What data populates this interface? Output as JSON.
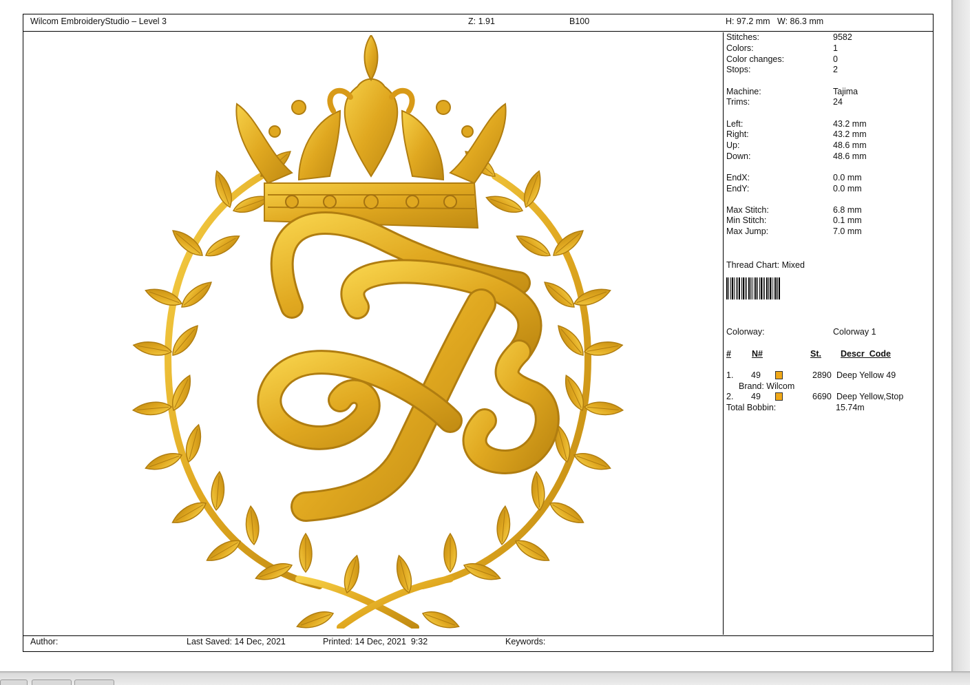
{
  "header": {
    "app_title": "Wilcom EmbroideryStudio – Level 3",
    "zoom": "Z: 1.91",
    "design_name": "B100",
    "dimensions": "H: 97.2 mm   W: 86.3 mm"
  },
  "stats": [
    {
      "label": "Stitches:",
      "value": "9582"
    },
    {
      "label": "Colors:",
      "value": "1"
    },
    {
      "label": "Color changes:",
      "value": "0"
    },
    {
      "label": "Stops:",
      "value": "2"
    },
    {
      "label": "Machine:",
      "value": "Tajima"
    },
    {
      "label": "Trims:",
      "value": "24"
    },
    {
      "label": "Left:",
      "value": "43.2 mm"
    },
    {
      "label": "Right:",
      "value": "43.2 mm"
    },
    {
      "label": "Up:",
      "value": "48.6 mm"
    },
    {
      "label": "Down:",
      "value": "48.6 mm"
    },
    {
      "label": "EndX:",
      "value": "0.0 mm"
    },
    {
      "label": "EndY:",
      "value": "0.0 mm"
    },
    {
      "label": "Max Stitch:",
      "value": "6.8 mm"
    },
    {
      "label": "Min Stitch:",
      "value": "0.1 mm"
    },
    {
      "label": "Max Jump:",
      "value": "7.0 mm"
    }
  ],
  "thread_chart": "Thread Chart: Mixed",
  "colorway": {
    "label": "Colorway:",
    "value": "Colorway 1"
  },
  "color_table": {
    "headers": {
      "num": "#",
      "n": "N#",
      "st": "St.",
      "descr": "Descr_Code"
    },
    "rows": [
      {
        "index": "1.",
        "n": "49",
        "st": "2890",
        "descr": "Deep Yellow 49",
        "brand": "Brand: Wilcom",
        "color": "#f0a818"
      },
      {
        "index": "2.",
        "n": "49",
        "st": "6690",
        "descr": "Deep Yellow,Stop",
        "color": "#f0a818"
      }
    ],
    "total_bobbin_label": "Total Bobbin:",
    "total_bobbin_value": "15.74m"
  },
  "footer": {
    "author": "Author:",
    "last_saved": "Last Saved: 14 Dec, 2021",
    "printed": "Printed: 14 Dec, 2021  9:32",
    "keywords": "Keywords:"
  },
  "colors": {
    "thread": "#e0a820",
    "thread_dark": "#b07d10",
    "thread_light": "#f6d048"
  }
}
